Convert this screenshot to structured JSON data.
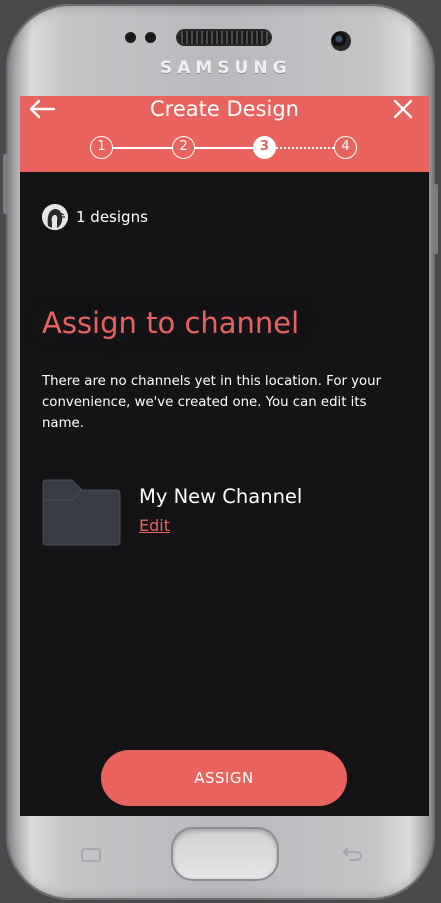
{
  "device": {
    "brand": "SAMSUNG"
  },
  "header": {
    "title": "Create Design",
    "back_icon": "arrow-left-icon",
    "close_icon": "close-icon",
    "steps": [
      "1",
      "2",
      "3",
      "4"
    ],
    "current_step": "3"
  },
  "designs": {
    "count_label": "1 designs"
  },
  "main": {
    "heading": "Assign to channel",
    "description": "There are no channels yet in this location. For your convenience, we've created one. You can edit its name."
  },
  "channel": {
    "name": "My New Channel",
    "edit_label": "Edit",
    "icon": "folder-icon"
  },
  "actions": {
    "assign_label": "ASSIGN"
  },
  "colors": {
    "accent": "#e8625e",
    "background": "#141417",
    "folder": "#3a3c45"
  }
}
